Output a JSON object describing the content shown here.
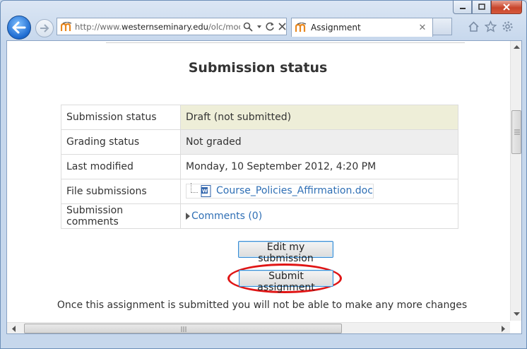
{
  "browser": {
    "url_prefix": "http://www.",
    "url_domain": "westernseminary.edu",
    "url_path": "/olc/mod/",
    "tab_title": "Assignment",
    "back_tooltip": "Back",
    "forward_tooltip": "Forward",
    "colors": {
      "back_button": "#1c6ad0",
      "close_button": "#c8452b"
    }
  },
  "page": {
    "heading": "Submission status",
    "rows": [
      {
        "label": "Submission status",
        "value": "Draft (not submitted)"
      },
      {
        "label": "Grading status",
        "value": "Not graded"
      },
      {
        "label": "Last modified",
        "value": "Monday, 10 September 2012, 4:20 PM"
      },
      {
        "label": "File submissions",
        "value": "Course_Policies_Affirmation.doc"
      },
      {
        "label": "Submission comments",
        "value": "Comments (0)"
      }
    ],
    "edit_button": "Edit my submission",
    "submit_button": "Submit assignment",
    "note": "Once this assignment is submitted you will not be able to make any more changes",
    "colors": {
      "highlight_ring": "#e01515",
      "link": "#2f6fb5",
      "draft_row": "#eeeed8"
    }
  }
}
